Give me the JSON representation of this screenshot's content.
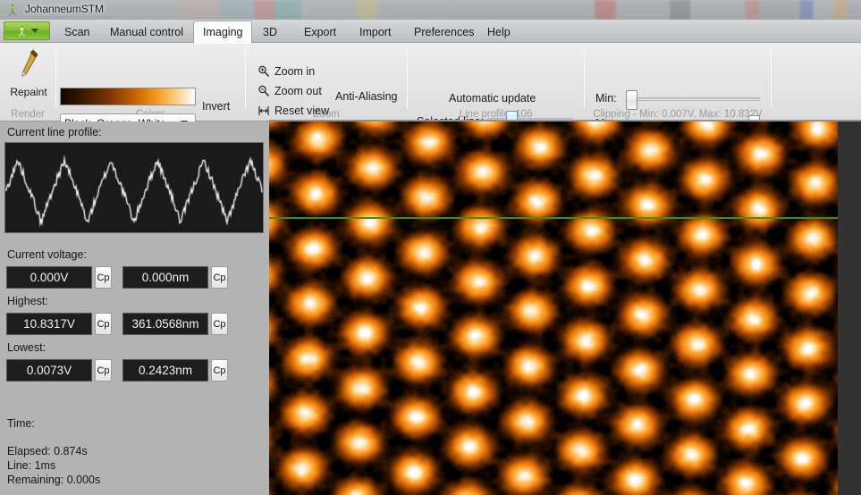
{
  "window": {
    "title": "JohanneumSTM",
    "app_icon": "stm-app-icon"
  },
  "ribbon": {
    "app_button": {
      "icon": "app-menu-icon",
      "caret": "chevron-down-icon"
    },
    "tabs": [
      {
        "label": "Scan",
        "active": false
      },
      {
        "label": "Manual control",
        "active": false
      },
      {
        "label": "Imaging",
        "active": true
      },
      {
        "label": "3D",
        "active": false
      },
      {
        "label": "Export",
        "active": false
      },
      {
        "label": "Import",
        "active": false
      },
      {
        "label": "Preferences",
        "active": false
      },
      {
        "label": "Help",
        "active": false
      }
    ],
    "groups": {
      "render": {
        "label": "Render",
        "repaint_label": "Repaint",
        "repaint_icon": "pencil-icon"
      },
      "colors": {
        "label": "Colors",
        "palette_value": "Black, Orange, White",
        "palette_caret": "chevron-down-icon",
        "invert_label": "Invert",
        "gradient_stops": [
          "#110702",
          "#7a3302",
          "#d06a05",
          "#f79a20",
          "#ffffff"
        ]
      },
      "zoom": {
        "label": "Zoom",
        "items": [
          {
            "label": "Zoom in",
            "icon": "zoom-in-icon"
          },
          {
            "label": "Zoom out",
            "icon": "zoom-out-icon"
          },
          {
            "label": "Reset view",
            "icon": "reset-view-icon"
          }
        ],
        "anti_aliasing_label": "Anti-Aliasing"
      },
      "line_profile": {
        "label": "Line profile: 106",
        "automatic_update_label": "Automatic update",
        "selected_line_label": "Selected line:",
        "selected_line_percent": 25
      },
      "clipping": {
        "label": "Clipping - Min: 0.007V, Max: 10.832V",
        "min_label": "Min:",
        "max_label": "Max:",
        "min_percent": 0,
        "max_percent": 100
      }
    }
  },
  "left_panel": {
    "current_line_profile_label": "Current line profile:",
    "sections": [
      {
        "label": "Current voltage:",
        "voltage": "0.000V",
        "distance": "0.000nm",
        "copy_label": "Cp"
      },
      {
        "label": "Highest:",
        "voltage": "10.8317V",
        "distance": "361.0568nm",
        "copy_label": "Cp"
      },
      {
        "label": "Lowest:",
        "voltage": "0.0073V",
        "distance": "0.2423nm",
        "copy_label": "Cp"
      }
    ],
    "time": {
      "heading": "Time:",
      "elapsed": "Elapsed: 0.874s",
      "line": "Line: 1ms",
      "remaining": "Remaining: 0.000s"
    }
  },
  "scan_image": {
    "description": "stm-scan-hexagonal-lattice",
    "selected_line_marker_color": "#3f8f12",
    "background_color": "#323232",
    "colormap": [
      "#000000",
      "#7a3302",
      "#e8750a",
      "#ffb340",
      "#ffffff"
    ]
  },
  "colors": {
    "panel_bg": "#b3b3b3",
    "ribbon_bg": "#eaeaea",
    "tab_active_bg": "#fbfbfb",
    "accent_green": "#84bd3a",
    "field_bg": "#1e1e1e"
  }
}
